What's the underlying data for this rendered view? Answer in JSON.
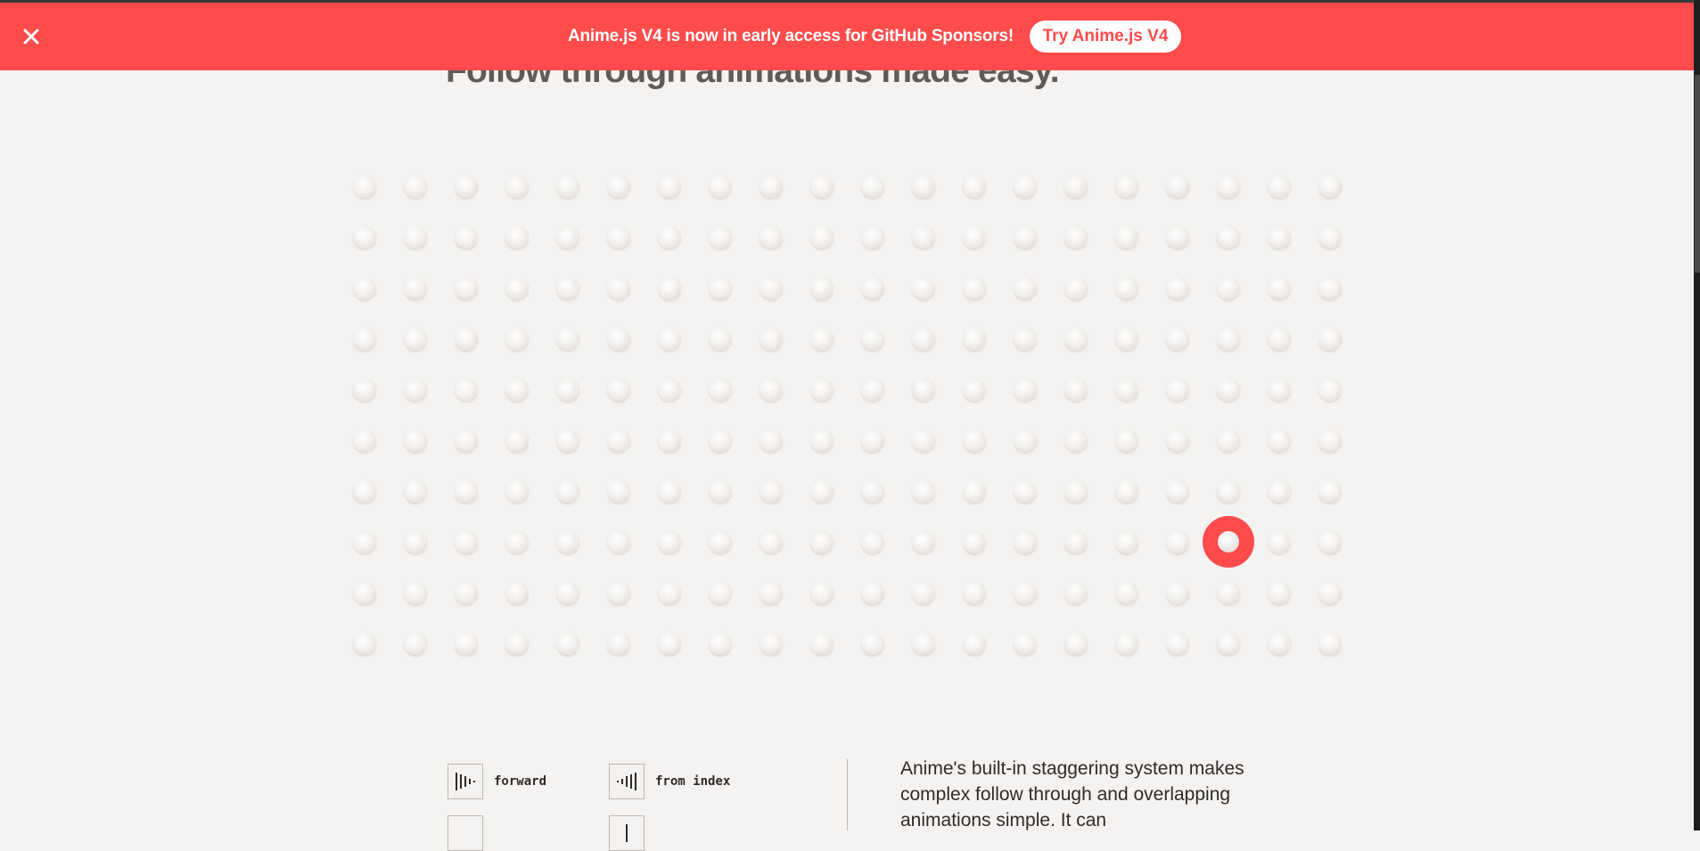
{
  "banner": {
    "text": "Anime.js V4 is now in early access for GitHub Sponsors!",
    "button_label": "Try Anime.js V4",
    "close_icon": "close-icon",
    "background_color": "#ff4b4b"
  },
  "section": {
    "title": "Follow through animations made easy."
  },
  "grid": {
    "columns": 20,
    "rows": 10,
    "active_cell": {
      "row": 8,
      "column": 18
    },
    "active_color": "#ff4b4b"
  },
  "controls": [
    {
      "label": "forward",
      "icon": "stagger-forward-icon"
    },
    {
      "label": "from index",
      "icon": "stagger-from-index-icon"
    }
  ],
  "description": "Anime's built-in staggering system makes complex follow through and overlapping animations simple. It can"
}
